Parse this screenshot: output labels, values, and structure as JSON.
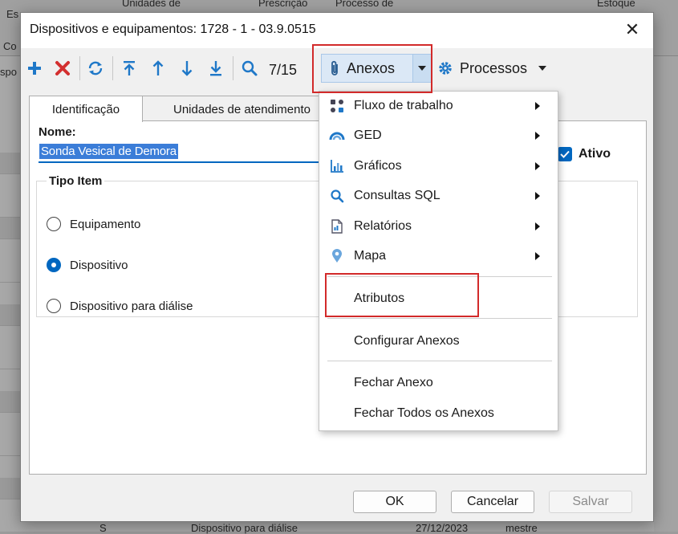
{
  "background": {
    "headers": [
      "Es",
      "Unidades de",
      "Prescrição",
      "Processo de",
      "Estoque",
      "Co",
      "spo"
    ],
    "bottom_row": [
      "S",
      "Dispositivo para diálise",
      "27/12/2023",
      "mestre"
    ]
  },
  "dialog": {
    "title": "Dispositivos e equipamentos: 1728 - 1 - 03.9.0515",
    "close_glyph": "✕"
  },
  "toolbar": {
    "counter": "7/15",
    "anexos_label": "Anexos",
    "processos_label": "Processos"
  },
  "tabs": [
    {
      "label": "Identificação",
      "active": true
    },
    {
      "label": "Unidades de atendimento",
      "active": false
    }
  ],
  "form": {
    "nome_label": "Nome:",
    "nome_value": "Sonda Vesical de Demora",
    "ativo_label": "Ativo",
    "ativo_checked": true,
    "tipo_item_title": "Tipo Item",
    "tipo_item_options": [
      {
        "label": "Equipamento",
        "selected": false
      },
      {
        "label": "Dispositivo",
        "selected": true
      },
      {
        "label": "Dispositivo para diálise",
        "selected": false
      }
    ]
  },
  "footer": {
    "ok_label": "OK",
    "cancel_label": "Cancelar",
    "save_label": "Salvar"
  },
  "menu": {
    "items": [
      {
        "label": "Fluxo de trabalho",
        "icon": "workflow-icon",
        "submenu": true
      },
      {
        "label": "GED",
        "icon": "ged-icon",
        "submenu": true
      },
      {
        "label": "Gráficos",
        "icon": "chart-icon",
        "submenu": true
      },
      {
        "label": "Consultas SQL",
        "icon": "search-icon",
        "submenu": true
      },
      {
        "label": "Relatórios",
        "icon": "report-icon",
        "submenu": true
      },
      {
        "label": "Mapa",
        "icon": "map-pin-icon",
        "submenu": true
      },
      {
        "label": "Atributos",
        "submenu": false
      },
      {
        "label": "Configurar Anexos",
        "submenu": false
      },
      {
        "label": "Fechar Anexo",
        "submenu": false
      },
      {
        "label": "Fechar Todos os Anexos",
        "submenu": false
      }
    ]
  },
  "colors": {
    "accent": "#0067c0",
    "highlight_red": "#d22a2a",
    "add_blue": "#1f78c8",
    "delete_red": "#d32f2f"
  }
}
